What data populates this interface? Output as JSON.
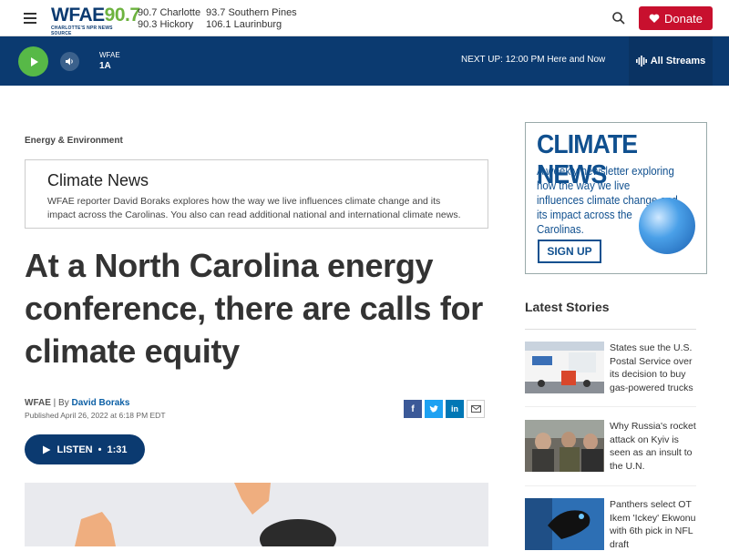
{
  "header": {
    "logo_main": "WFAE",
    "logo_num": "90.7",
    "logo_sub": "CHARLOTTE'S NPR NEWS SOURCE",
    "frequencies": [
      [
        "90.7 Charlotte",
        "93.7 Southern Pines"
      ],
      [
        "90.3 Hickory",
        "106.1 Laurinburg"
      ]
    ],
    "donate_label": "Donate"
  },
  "player": {
    "station_label": "WFAE",
    "program": "1A",
    "next_up": "NEXT UP: 12:00 PM",
    "next_program": "Here and Now",
    "all_streams": "All Streams"
  },
  "article": {
    "category": "Energy & Environment",
    "box_title": "Climate News",
    "box_text": "WFAE reporter David Boraks explores how the way we live influences climate change and its impact across the Carolinas. You also can read additional national and international climate news.",
    "headline": "At a North Carolina energy conference, there are calls for climate equity",
    "byline_org": "WFAE",
    "byline_sep": " | By ",
    "author": "David Boraks",
    "published": "Published April 26, 2022 at 6:18 PM EDT",
    "listen_label": "LISTEN",
    "listen_duration": "1:31"
  },
  "ad": {
    "title": "CLIMATE NEWS",
    "text": "A weekly newsletter exploring how the way we live influences climate change and its impact across the Carolinas.",
    "button": "SIGN UP"
  },
  "sidebar": {
    "latest_title": "Latest Stories",
    "stories": [
      {
        "title": "States sue the U.S. Postal Service over its decision to buy gas-powered trucks"
      },
      {
        "title": "Why Russia's rocket attack on Kyiv is seen as an insult to the U.N."
      },
      {
        "title": "Panthers select OT Ikem 'Ickey' Ekwonu with 6th pick in NFL draft"
      }
    ]
  },
  "colors": {
    "brand_blue": "#0b3a70",
    "donate_red": "#c8102e",
    "play_green": "#57b947",
    "facebook": "#3b5998",
    "twitter": "#1da1f2",
    "linkedin": "#0077b5"
  }
}
